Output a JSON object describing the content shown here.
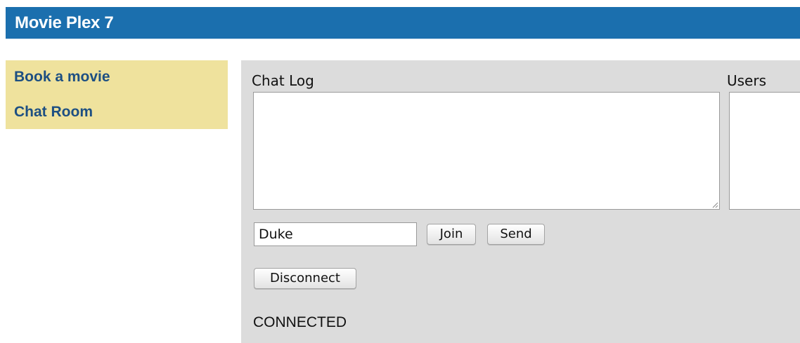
{
  "header": {
    "title": "Movie Plex 7"
  },
  "sidebar": {
    "items": [
      {
        "label": "Book a movie"
      },
      {
        "label": "Chat Room"
      }
    ]
  },
  "chat": {
    "log_label": "Chat Log",
    "log_value": "",
    "users_label": "Users",
    "name_value": "Duke",
    "join_label": "Join",
    "send_label": "Send",
    "disconnect_label": "Disconnect",
    "status": "CONNECTED"
  },
  "colors": {
    "header_bg": "#1b6fae",
    "sidebar_bg": "#efe29d",
    "link_color": "#1d4f82",
    "content_bg": "#dcdcdc"
  }
}
